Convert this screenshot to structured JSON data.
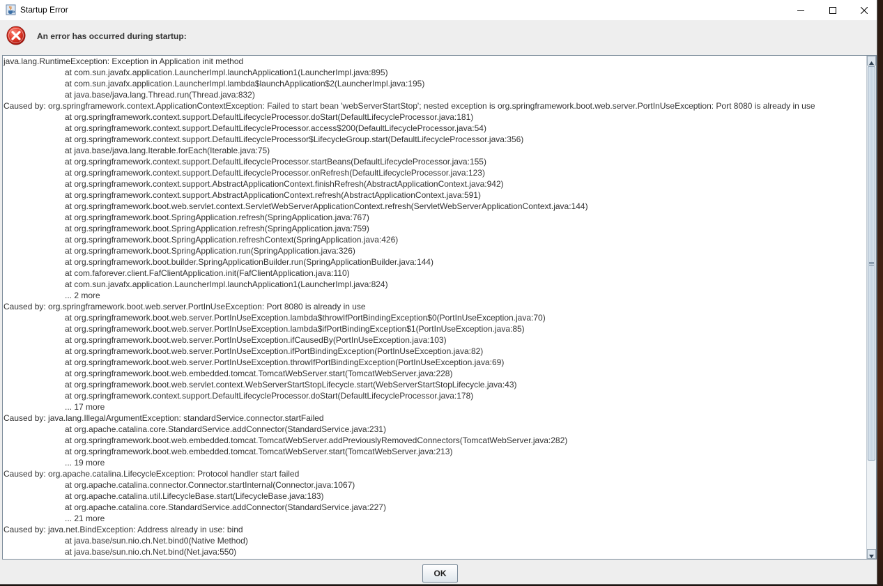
{
  "window": {
    "title": "Startup Error",
    "minimize_icon": "minimize-icon",
    "maximize_icon": "maximize-icon",
    "close_icon": "close-icon"
  },
  "header": {
    "icon": "error-icon",
    "message": "An error has occurred during startup:"
  },
  "stacktrace": {
    "lines": [
      {
        "indent": false,
        "text": "java.lang.RuntimeException: Exception in Application init method"
      },
      {
        "indent": true,
        "text": "at com.sun.javafx.application.LauncherImpl.launchApplication1(LauncherImpl.java:895)"
      },
      {
        "indent": true,
        "text": "at com.sun.javafx.application.LauncherImpl.lambda$launchApplication$2(LauncherImpl.java:195)"
      },
      {
        "indent": true,
        "text": "at java.base/java.lang.Thread.run(Thread.java:832)"
      },
      {
        "indent": false,
        "text": "Caused by: org.springframework.context.ApplicationContextException: Failed to start bean 'webServerStartStop'; nested exception is org.springframework.boot.web.server.PortInUseException: Port 8080 is already in use"
      },
      {
        "indent": true,
        "text": "at org.springframework.context.support.DefaultLifecycleProcessor.doStart(DefaultLifecycleProcessor.java:181)"
      },
      {
        "indent": true,
        "text": "at org.springframework.context.support.DefaultLifecycleProcessor.access$200(DefaultLifecycleProcessor.java:54)"
      },
      {
        "indent": true,
        "text": "at org.springframework.context.support.DefaultLifecycleProcessor$LifecycleGroup.start(DefaultLifecycleProcessor.java:356)"
      },
      {
        "indent": true,
        "text": "at java.base/java.lang.Iterable.forEach(Iterable.java:75)"
      },
      {
        "indent": true,
        "text": "at org.springframework.context.support.DefaultLifecycleProcessor.startBeans(DefaultLifecycleProcessor.java:155)"
      },
      {
        "indent": true,
        "text": "at org.springframework.context.support.DefaultLifecycleProcessor.onRefresh(DefaultLifecycleProcessor.java:123)"
      },
      {
        "indent": true,
        "text": "at org.springframework.context.support.AbstractApplicationContext.finishRefresh(AbstractApplicationContext.java:942)"
      },
      {
        "indent": true,
        "text": "at org.springframework.context.support.AbstractApplicationContext.refresh(AbstractApplicationContext.java:591)"
      },
      {
        "indent": true,
        "text": "at org.springframework.boot.web.servlet.context.ServletWebServerApplicationContext.refresh(ServletWebServerApplicationContext.java:144)"
      },
      {
        "indent": true,
        "text": "at org.springframework.boot.SpringApplication.refresh(SpringApplication.java:767)"
      },
      {
        "indent": true,
        "text": "at org.springframework.boot.SpringApplication.refresh(SpringApplication.java:759)"
      },
      {
        "indent": true,
        "text": "at org.springframework.boot.SpringApplication.refreshContext(SpringApplication.java:426)"
      },
      {
        "indent": true,
        "text": "at org.springframework.boot.SpringApplication.run(SpringApplication.java:326)"
      },
      {
        "indent": true,
        "text": "at org.springframework.boot.builder.SpringApplicationBuilder.run(SpringApplicationBuilder.java:144)"
      },
      {
        "indent": true,
        "text": "at com.faforever.client.FafClientApplication.init(FafClientApplication.java:110)"
      },
      {
        "indent": true,
        "text": "at com.sun.javafx.application.LauncherImpl.launchApplication1(LauncherImpl.java:824)"
      },
      {
        "indent": true,
        "text": "... 2 more"
      },
      {
        "indent": false,
        "text": "Caused by: org.springframework.boot.web.server.PortInUseException: Port 8080 is already in use"
      },
      {
        "indent": true,
        "text": "at org.springframework.boot.web.server.PortInUseException.lambda$throwIfPortBindingException$0(PortInUseException.java:70)"
      },
      {
        "indent": true,
        "text": "at org.springframework.boot.web.server.PortInUseException.lambda$ifPortBindingException$1(PortInUseException.java:85)"
      },
      {
        "indent": true,
        "text": "at org.springframework.boot.web.server.PortInUseException.ifCausedBy(PortInUseException.java:103)"
      },
      {
        "indent": true,
        "text": "at org.springframework.boot.web.server.PortInUseException.ifPortBindingException(PortInUseException.java:82)"
      },
      {
        "indent": true,
        "text": "at org.springframework.boot.web.server.PortInUseException.throwIfPortBindingException(PortInUseException.java:69)"
      },
      {
        "indent": true,
        "text": "at org.springframework.boot.web.embedded.tomcat.TomcatWebServer.start(TomcatWebServer.java:228)"
      },
      {
        "indent": true,
        "text": "at org.springframework.boot.web.servlet.context.WebServerStartStopLifecycle.start(WebServerStartStopLifecycle.java:43)"
      },
      {
        "indent": true,
        "text": "at org.springframework.context.support.DefaultLifecycleProcessor.doStart(DefaultLifecycleProcessor.java:178)"
      },
      {
        "indent": true,
        "text": "... 17 more"
      },
      {
        "indent": false,
        "text": "Caused by: java.lang.IllegalArgumentException: standardService.connector.startFailed"
      },
      {
        "indent": true,
        "text": "at org.apache.catalina.core.StandardService.addConnector(StandardService.java:231)"
      },
      {
        "indent": true,
        "text": "at org.springframework.boot.web.embedded.tomcat.TomcatWebServer.addPreviouslyRemovedConnectors(TomcatWebServer.java:282)"
      },
      {
        "indent": true,
        "text": "at org.springframework.boot.web.embedded.tomcat.TomcatWebServer.start(TomcatWebServer.java:213)"
      },
      {
        "indent": true,
        "text": "... 19 more"
      },
      {
        "indent": false,
        "text": "Caused by: org.apache.catalina.LifecycleException: Protocol handler start failed"
      },
      {
        "indent": true,
        "text": "at org.apache.catalina.connector.Connector.startInternal(Connector.java:1067)"
      },
      {
        "indent": true,
        "text": "at org.apache.catalina.util.LifecycleBase.start(LifecycleBase.java:183)"
      },
      {
        "indent": true,
        "text": "at org.apache.catalina.core.StandardService.addConnector(StandardService.java:227)"
      },
      {
        "indent": true,
        "text": "... 21 more"
      },
      {
        "indent": false,
        "text": "Caused by: java.net.BindException: Address already in use: bind"
      },
      {
        "indent": true,
        "text": "at java.base/sun.nio.ch.Net.bind0(Native Method)"
      },
      {
        "indent": true,
        "text": "at java.base/sun.nio.ch.Net.bind(Net.java:550)"
      }
    ]
  },
  "buttons": {
    "ok_label": "OK"
  }
}
